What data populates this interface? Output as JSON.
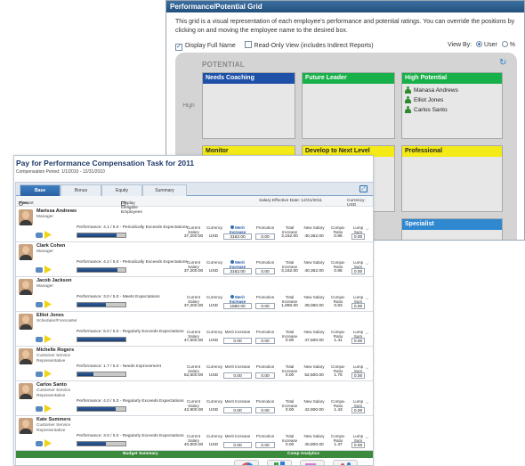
{
  "grid": {
    "title": "Performance/Potential Grid",
    "intro": "This grid is a visual representation of each employee's performance and potential ratings. You can override the positions by clicking on and moving the employee name to the desired box.",
    "display_full_name": "Display Full Name",
    "read_only_view": "Read-Only View (includes Indirect Reports)",
    "view_by": "View By:",
    "view_by_user": "User",
    "view_by_pct": "%",
    "potential_label": "POTENTIAL",
    "high_label": "High",
    "boxes": [
      {
        "title": "Needs Coaching",
        "color": "#1e50a8",
        "employees": []
      },
      {
        "title": "Future Leader",
        "color": "#17b049",
        "employees": []
      },
      {
        "title": "High Potential",
        "color": "#17b049",
        "employees": [
          "Manasa Andrews",
          "Elliot Jones",
          "Carlos Santo"
        ]
      },
      {
        "title": "Monitor",
        "color": "#f4ea17",
        "employees": []
      },
      {
        "title": "Develop to Next Level",
        "color": "#f4ea17",
        "employees": []
      },
      {
        "title": "Professional",
        "color": "#f4ea17",
        "employees": []
      },
      {
        "title": "",
        "color": "#e23628",
        "employees": []
      },
      {
        "title": "Specialist",
        "color": "#2f88d0",
        "employees": []
      }
    ]
  },
  "pfp": {
    "title": "Pay for Performance Compensation Task for 2011",
    "period": "Compensation Period: 1/1/2010 - 12/31/2010",
    "tabs": [
      "Base",
      "Bonus",
      "Equity",
      "Summary"
    ],
    "view_label": "View:",
    "view_amount": "Amount",
    "view_pct": "%",
    "display_ineligible": "Display Ineligible Employees",
    "salary_effective": "Salary Effective Date: 12/31/2011",
    "currency_label": "Currency: USD",
    "col_labels": {
      "current_salary": "Current Salary",
      "currency": "Currency",
      "merit_increase": "Merit Increase",
      "promotion": "Promotion",
      "total_increase": "Total Increase",
      "new_salary": "New Salary",
      "compa_ratio": "Compa-Ratio",
      "lump_sum": "Lump Sum"
    },
    "employees": [
      {
        "name": "Marissa Andrews",
        "title": "Manager",
        "performance": "Performance: 4.1 / 5.0 - Periodically Exceeds Expectations",
        "perf_fraction": 0.82,
        "current_salary": "37,200.00",
        "currency": "USD",
        "merit": "3162.00",
        "merit_highlight": true,
        "promotion": "0.00",
        "total": "3,162.00",
        "new_salary": "40,362.00",
        "compa": "0.86",
        "lump": "0.00"
      },
      {
        "name": "Clark Cohen",
        "title": "Manager",
        "performance": "Performance: 4.2 / 5.0 - Periodically Exceeds Expectations",
        "perf_fraction": 0.84,
        "current_salary": "37,200.00",
        "currency": "USD",
        "merit": "3162.00",
        "merit_highlight": true,
        "promotion": "0.00",
        "total": "3,162.00",
        "new_salary": "40,362.00",
        "compa": "0.86",
        "lump": "0.00"
      },
      {
        "name": "Jacob Jackson",
        "title": "Manager",
        "performance": "Performance: 3.0 / 5.0 - Meets Expectations",
        "perf_fraction": 0.6,
        "current_salary": "37,200.00",
        "currency": "USD",
        "merit": "1860.00",
        "merit_highlight": true,
        "promotion": "0.00",
        "total": "1,860.00",
        "new_salary": "39,060.00",
        "compa": "0.83",
        "lump": "0.00"
      },
      {
        "name": "Elliot Jones",
        "title": "Scheduler/Forecaster",
        "performance": "Performance: 5.0 / 5.0 - Regularly Exceeds Expectations",
        "perf_fraction": 1.0,
        "current_salary": "47,500.00",
        "currency": "USD",
        "merit": "0.00",
        "merit_highlight": false,
        "promotion": "0.00",
        "total": "0.00",
        "new_salary": "47,500.00",
        "compa": "1.41",
        "lump": "0.00"
      },
      {
        "name": "Michelle Rogers",
        "title": "Customer Service Representative",
        "performance": "Performance: 1.7 / 5.0 - Needs Improvement",
        "perf_fraction": 0.34,
        "current_salary": "52,500.00",
        "currency": "USD",
        "merit": "0.00",
        "merit_highlight": false,
        "promotion": "0.00",
        "total": "0.00",
        "new_salary": "52,500.00",
        "compa": "1.76",
        "lump": "0.00"
      },
      {
        "name": "Carlos Santo",
        "title": "Customer Service Representative",
        "performance": "Performance: 4.0 / 5.0 - Regularly Exceeds Expectations",
        "perf_fraction": 0.8,
        "current_salary": "42,900.00",
        "currency": "USD",
        "merit": "0.00",
        "merit_highlight": false,
        "promotion": "0.00",
        "total": "0.00",
        "new_salary": "42,900.00",
        "compa": "1.43",
        "lump": "0.00"
      },
      {
        "name": "Kate Summers",
        "title": "Customer Service Representative",
        "performance": "Performance: 3.0 / 5.0 - Regularly Exceeds Expectations",
        "perf_fraction": 0.6,
        "current_salary": "40,800.00",
        "currency": "USD",
        "merit": "0.00",
        "merit_highlight": false,
        "promotion": "0.00",
        "total": "0.00",
        "new_salary": "40,800.00",
        "compa": "1.37",
        "lump": "0.00"
      }
    ],
    "budget_summary": "Budget Summary",
    "comp_analytics": "Comp Analytics"
  }
}
